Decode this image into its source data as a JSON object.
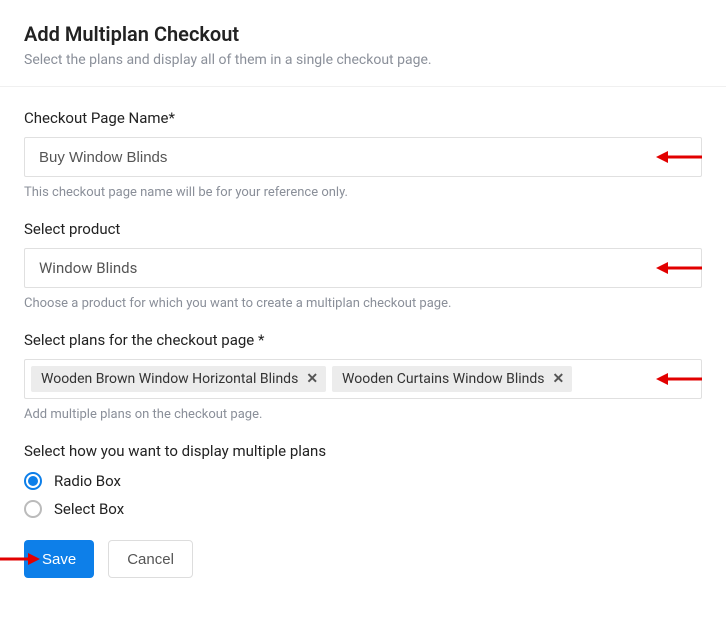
{
  "header": {
    "title": "Add Multiplan Checkout",
    "subtitle": "Select the plans and display all of them in a single checkout page."
  },
  "form": {
    "name": {
      "label": "Checkout Page Name*",
      "value": "Buy Window Blinds",
      "helper": "This checkout page name will be for your reference only."
    },
    "product": {
      "label": "Select product",
      "value": "Window Blinds",
      "helper": "Choose a product for which you want to create a multiplan checkout page."
    },
    "plans": {
      "label": "Select plans for the checkout page *",
      "tags": [
        "Wooden Brown Window Horizontal Blinds",
        "Wooden Curtains Window Blinds"
      ],
      "helper": "Add multiple plans on the checkout page."
    },
    "display": {
      "label": "Select how you want to display multiple plans",
      "options": [
        {
          "label": "Radio Box",
          "checked": true
        },
        {
          "label": "Select Box",
          "checked": false
        }
      ]
    }
  },
  "actions": {
    "save": "Save",
    "cancel": "Cancel"
  },
  "colors": {
    "primary": "#0d7fe9",
    "arrow": "#e20000"
  }
}
